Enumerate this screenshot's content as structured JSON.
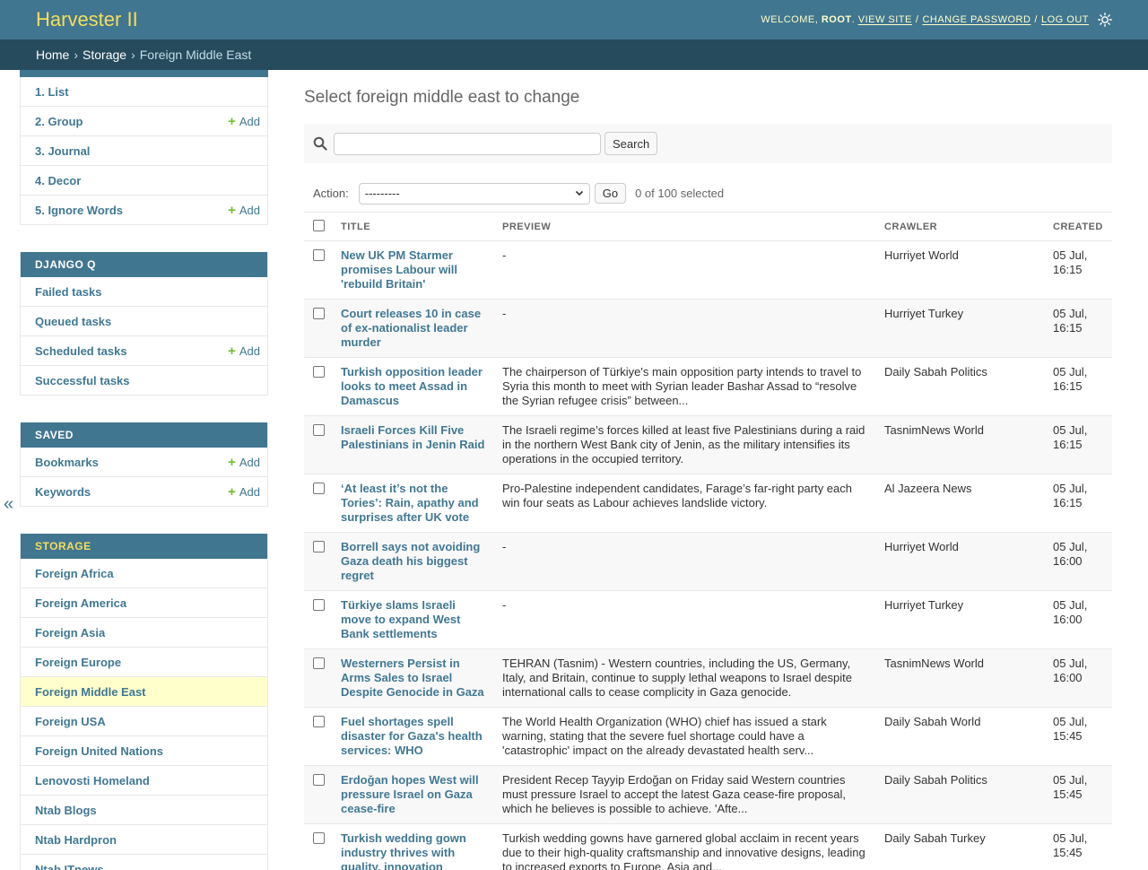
{
  "header": {
    "brand": "Harvester II",
    "welcome": "Welcome,",
    "username": "root",
    "view_site": "View site",
    "change_password": "Change password",
    "log_out": "Log out"
  },
  "breadcrumbs": [
    "Home",
    "Storage",
    "Foreign Middle East"
  ],
  "sidebar": {
    "toggle": "«",
    "add_label": "Add",
    "top_items": [
      {
        "label": "1. List",
        "add": false
      },
      {
        "label": "2. Group",
        "add": true
      },
      {
        "label": "3. Journal",
        "add": false
      },
      {
        "label": "4. Decor",
        "add": false
      },
      {
        "label": "5. Ignore Words",
        "add": true
      }
    ],
    "django_q": {
      "caption": "Django Q",
      "items": [
        {
          "label": "Failed tasks",
          "add": false
        },
        {
          "label": "Queued tasks",
          "add": false
        },
        {
          "label": "Scheduled tasks",
          "add": true
        },
        {
          "label": "Successful tasks",
          "add": false
        }
      ]
    },
    "saved": {
      "caption": "Saved",
      "items": [
        {
          "label": "Bookmarks",
          "add": true
        },
        {
          "label": "Keywords",
          "add": true
        }
      ]
    },
    "storage": {
      "caption": "Storage",
      "items": [
        {
          "label": "Foreign Africa"
        },
        {
          "label": "Foreign America"
        },
        {
          "label": "Foreign Asia"
        },
        {
          "label": "Foreign Europe"
        },
        {
          "label": "Foreign Middle East",
          "active": true
        },
        {
          "label": "Foreign USA"
        },
        {
          "label": "Foreign United Nations"
        },
        {
          "label": "Lenovosti Homeland"
        },
        {
          "label": "Ntab Blogs"
        },
        {
          "label": "Ntab Hardpron"
        },
        {
          "label": "Ntab ITnews"
        }
      ]
    }
  },
  "main": {
    "title": "Select foreign middle east to change",
    "search": {
      "value": "",
      "button": "Search"
    },
    "actions": {
      "label": "Action:",
      "selected": "---------",
      "go": "Go",
      "count": "0 of 100 selected"
    },
    "columns": [
      "Title",
      "Preview",
      "Crawler",
      "Created"
    ],
    "rows": [
      {
        "title": "New UK PM Starmer promises Labour will 'rebuild Britain'",
        "preview": "-",
        "crawler": "Hurriyet World",
        "created": "05 Jul, 16:15"
      },
      {
        "title": "Court releases 10 in case of ex-nationalist leader murder",
        "preview": "-",
        "crawler": "Hurriyet Turkey",
        "created": "05 Jul, 16:15"
      },
      {
        "title": "Turkish opposition leader looks to meet Assad in Damascus",
        "preview": "The chairperson of Türkiye's main opposition party intends to travel to Syria this month to meet with Syrian leader Bashar Assad to “resolve the Syrian refugee crisis” between...",
        "crawler": "Daily Sabah Politics",
        "created": "05 Jul, 16:15"
      },
      {
        "title": "Israeli Forces Kill Five Palestinians in Jenin Raid",
        "preview": "The Israeli regime’s forces killed at least five Palestinians during a raid in the northern West Bank city of Jenin, as the military intensifies its operations in the occupied territory.",
        "crawler": "TasnimNews World",
        "created": "05 Jul, 16:15"
      },
      {
        "title": "‘At least it’s not the Tories’: Rain, apathy and surprises after UK vote",
        "preview": "Pro-Palestine independent candidates, Farage’s far-right party each win four seats as Labour achieves landslide victory.",
        "crawler": "Al Jazeera News",
        "created": "05 Jul, 16:15"
      },
      {
        "title": "Borrell says not avoiding Gaza death his biggest regret",
        "preview": "-",
        "crawler": "Hurriyet World",
        "created": "05 Jul, 16:00"
      },
      {
        "title": "Türkiye slams Israeli move to expand West Bank settlements",
        "preview": "-",
        "crawler": "Hurriyet Turkey",
        "created": "05 Jul, 16:00"
      },
      {
        "title": "Westerners Persist in Arms Sales to Israel Despite Genocide in Gaza",
        "preview": "TEHRAN (Tasnim) - Western countries, including the US, Germany, Italy, and Britain, continue to supply lethal weapons to Israel despite international calls to cease complicity in Gaza genocide.",
        "crawler": "TasnimNews World",
        "created": "05 Jul, 16:00"
      },
      {
        "title": "Fuel shortages spell disaster for Gaza's health services: WHO",
        "preview": "The World Health Organization (WHO) chief has issued a stark warning, stating that the severe fuel shortage could have a 'catastrophic' impact on the already devastated health serv...",
        "crawler": "Daily Sabah World",
        "created": "05 Jul, 15:45"
      },
      {
        "title": "Erdoğan hopes West will pressure Israel on Gaza cease-fire",
        "preview": "President Recep Tayyip Erdoğan on Friday said Western countries must pressure Israel to accept the latest Gaza cease-fire proposal, which he believes is possible to achieve. 'Afte...",
        "crawler": "Daily Sabah Politics",
        "created": "05 Jul, 15:45"
      },
      {
        "title": "Turkish wedding gown industry thrives with quality, innovation",
        "preview": "Turkish wedding gowns have garnered global acclaim in recent years due to their high-quality craftsmanship and innovative designs, leading to increased exports to Europe, Asia and...",
        "crawler": "Daily Sabah Turkey",
        "created": "05 Jul, 15:45"
      }
    ]
  }
}
